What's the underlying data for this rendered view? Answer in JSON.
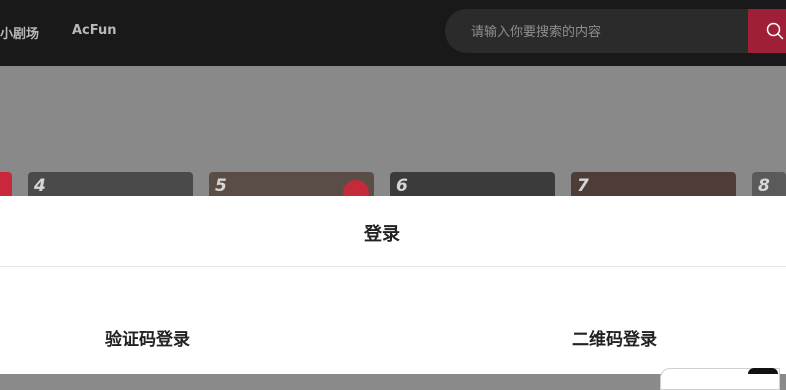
{
  "header": {
    "nav_items": [
      "小剧场",
      "AcFun"
    ],
    "search": {
      "placeholder": "请输入你要搜索的内容",
      "button_icon": "search-icon"
    }
  },
  "ranking": {
    "items": [
      {
        "rank": "4"
      },
      {
        "rank": "5"
      },
      {
        "rank": "6"
      },
      {
        "rank": "7"
      },
      {
        "rank": "8"
      }
    ]
  },
  "login": {
    "title": "登录",
    "tabs": {
      "sms": "验证码登录",
      "qr": "二维码登录"
    }
  },
  "colors": {
    "topbar": "#191919",
    "accent": "#9e1f37",
    "overlay": "#898989"
  }
}
